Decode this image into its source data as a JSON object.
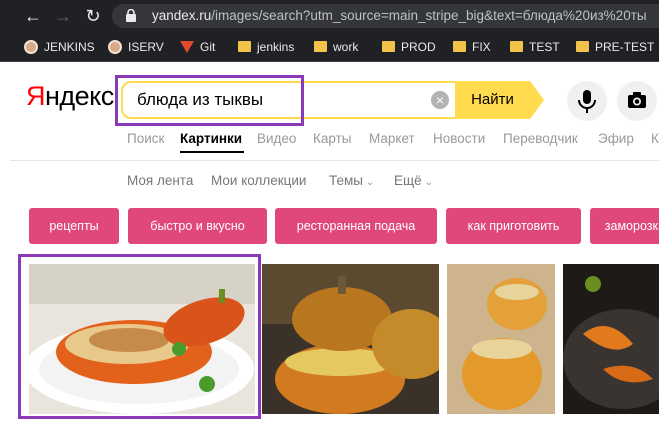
{
  "browser": {
    "url_host": "yandex.ru",
    "url_rest": "/images/search?utm_source=main_stripe_big&text=блюда%20из%20ты"
  },
  "bookmarks": [
    {
      "label": "JENKINS",
      "icon": "person-avatar-icon"
    },
    {
      "label": "ISERV",
      "icon": "person-avatar-icon"
    },
    {
      "label": "Git",
      "icon": "gitlab-icon"
    },
    {
      "label": "jenkins",
      "icon": "folder-icon"
    },
    {
      "label": "work",
      "icon": "folder-icon"
    },
    {
      "label": "PROD",
      "icon": "folder-icon"
    },
    {
      "label": "FIX",
      "icon": "folder-icon"
    },
    {
      "label": "TEST",
      "icon": "folder-icon"
    },
    {
      "label": "PRE-TEST",
      "icon": "folder-icon"
    }
  ],
  "logo": {
    "first": "Я",
    "rest": "ндекс"
  },
  "search": {
    "query": "блюда из тыквы",
    "button": "Найти"
  },
  "tabs": [
    "Поиск",
    "Картинки",
    "Видео",
    "Карты",
    "Маркет",
    "Новости",
    "Переводчик",
    "Эфир",
    "К"
  ],
  "active_tab": "Картинки",
  "subnav": {
    "feed": "Моя лента",
    "collections": "Мои коллекции",
    "themes": "Темы",
    "more": "Ещё"
  },
  "chips": [
    "рецепты",
    "быстро и вкусно",
    "ресторанная подача",
    "как приготовить",
    "заморозка"
  ],
  "colors": {
    "accent_yellow": "#ffdb4d",
    "chip_pink": "#e0487d",
    "highlight": "#8a3ab9",
    "logo_red": "#ff0000"
  }
}
